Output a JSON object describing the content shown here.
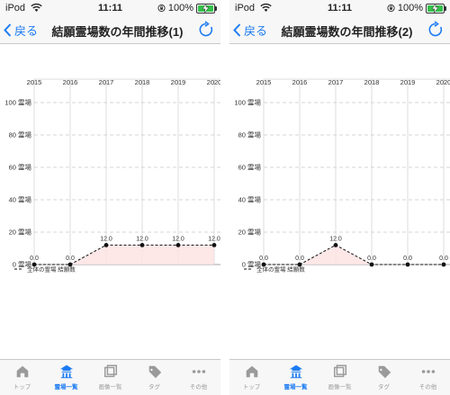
{
  "status": {
    "carrier": "iPod",
    "time": "11:11",
    "battery": "100%"
  },
  "nav": {
    "back_label": "戻る"
  },
  "screens": [
    {
      "title": "結願霊場数の年間推移(1)",
      "chart_data": {
        "type": "area",
        "x": [
          "2015",
          "2016",
          "2017",
          "2018",
          "2019",
          "2020"
        ],
        "y_ticks": [
          "0 霊場",
          "20 霊場",
          "40 霊場",
          "60 霊場",
          "80 霊場",
          "100 霊場"
        ],
        "ylim": [
          0,
          100
        ],
        "series": [
          {
            "name": "全体の霊場 結願数",
            "values": [
              0,
              0,
              12,
              12,
              12,
              12
            ],
            "labels": [
              "0.0",
              "0.0",
              "12.0",
              "12.0",
              "12.0",
              "12.0"
            ]
          }
        ],
        "grid": true,
        "legend": "bottom-left"
      }
    },
    {
      "title": "結願霊場数の年間推移(2)",
      "chart_data": {
        "type": "area",
        "x": [
          "2015",
          "2016",
          "2017",
          "2018",
          "2019",
          "2020"
        ],
        "y_ticks": [
          "0 霊場",
          "20 霊場",
          "40 霊場",
          "60 霊場",
          "80 霊場",
          "100 霊場"
        ],
        "ylim": [
          0,
          100
        ],
        "series": [
          {
            "name": "全体の霊場 結願数",
            "values": [
              0,
              0,
              12,
              0,
              0,
              0
            ],
            "labels": [
              "0.0",
              "0.0",
              "12.0",
              "0.0",
              "0.0",
              "0.0"
            ]
          }
        ],
        "grid": true,
        "legend": "bottom-left"
      }
    }
  ],
  "tabs": [
    {
      "label": "トップ",
      "icon": "house-icon",
      "active": false
    },
    {
      "label": "霊場一覧",
      "icon": "temple-icon",
      "active": true
    },
    {
      "label": "画像一覧",
      "icon": "gallery-icon",
      "active": false
    },
    {
      "label": "タグ",
      "icon": "tag-icon",
      "active": false
    },
    {
      "label": "その他",
      "icon": "more-icon",
      "active": false
    }
  ],
  "colors": {
    "accent": "#1e7cf2",
    "inactive": "#9a9a9a",
    "fill": "#fde3e3",
    "battery": "#33c04a"
  }
}
